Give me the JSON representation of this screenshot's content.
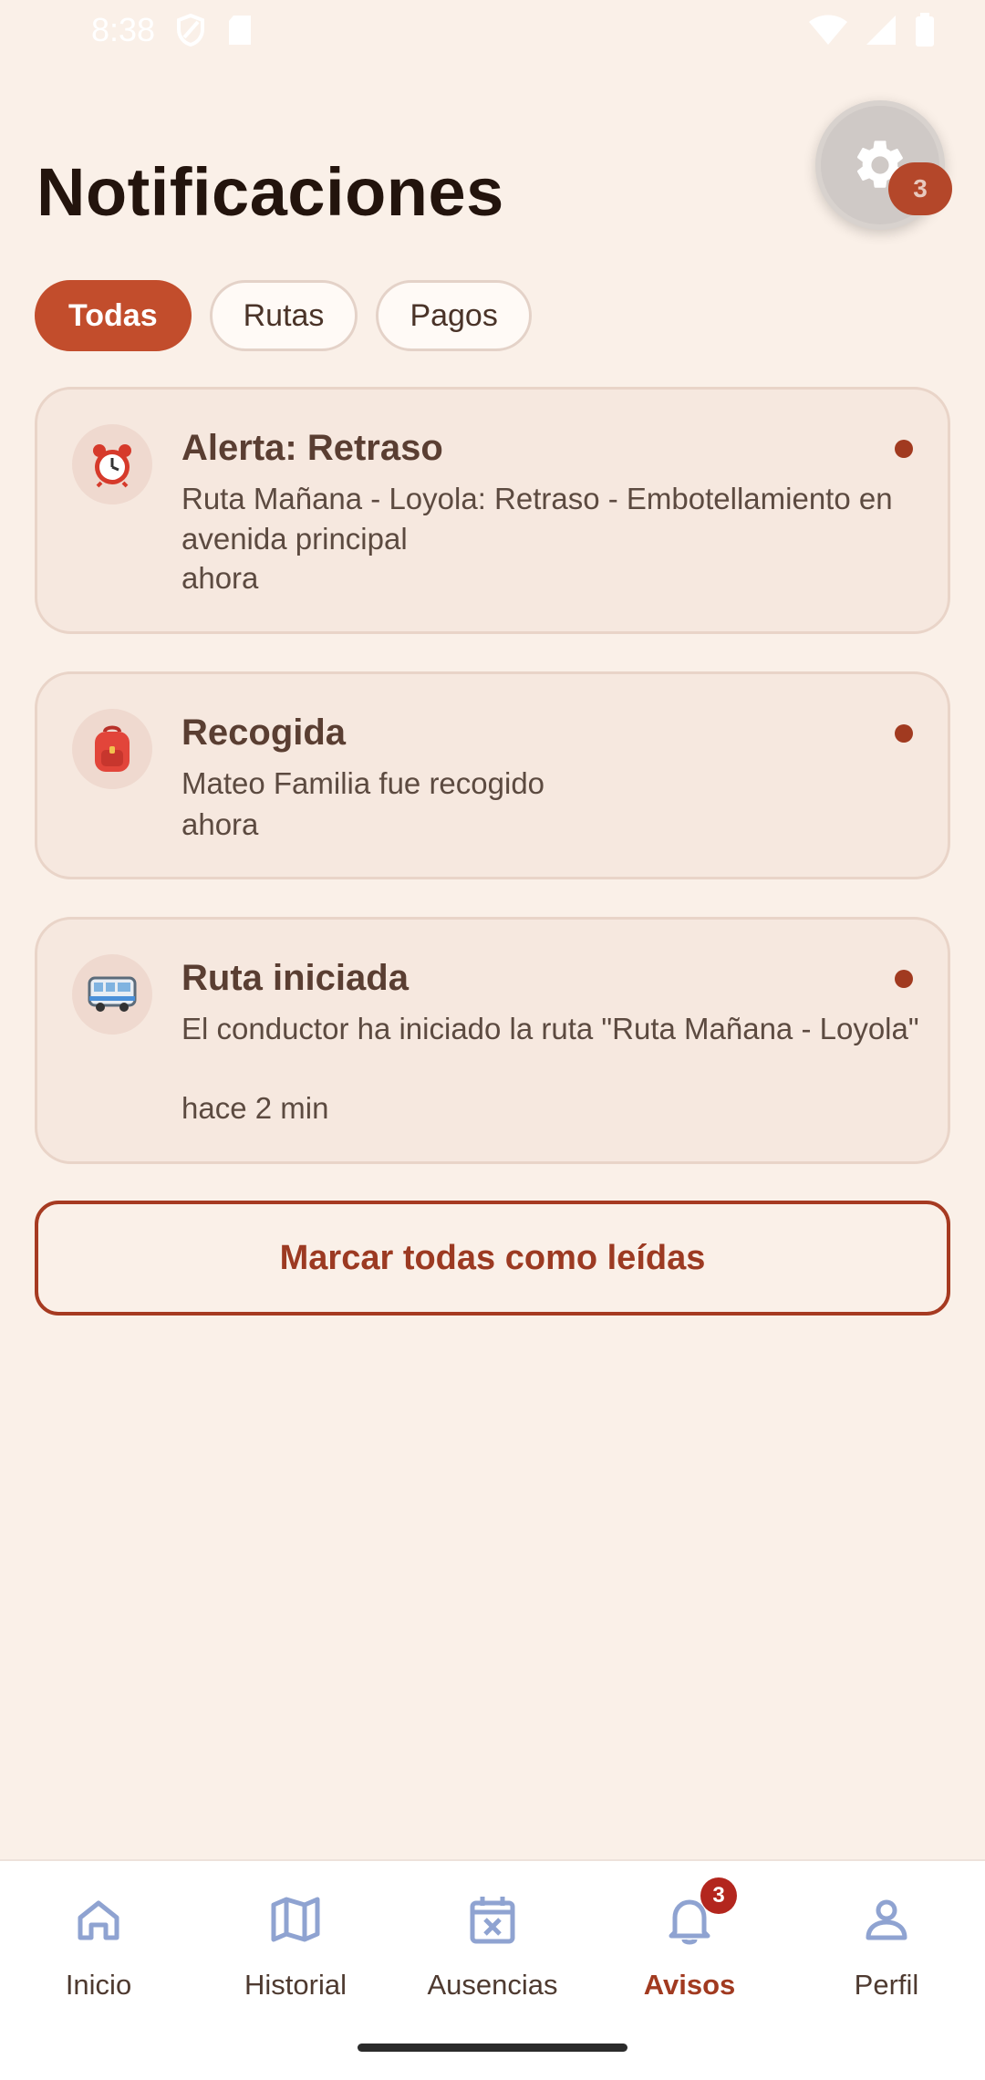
{
  "status_bar": {
    "time": "8:38"
  },
  "header": {
    "title": "Notificaciones",
    "settings_badge": "3"
  },
  "filters": [
    {
      "label": "Todas",
      "active": true
    },
    {
      "label": "Rutas",
      "active": false
    },
    {
      "label": "Pagos",
      "active": false
    }
  ],
  "notifications": [
    {
      "icon": "alarm-clock-icon",
      "title": "Alerta: Retraso",
      "message": "Ruta Mañana - Loyola: Retraso - Embotellamiento en avenida principal",
      "time": "ahora",
      "unread": true
    },
    {
      "icon": "backpack-icon",
      "title": "Recogida",
      "message": "Mateo Familia fue recogido",
      "time": "ahora",
      "unread": true
    },
    {
      "icon": "bus-icon",
      "title": "Ruta iniciada",
      "message": "El conductor ha iniciado la ruta \"Ruta Mañana - Loyola\"",
      "time": "hace 2 min",
      "unread": true
    }
  ],
  "mark_all_label": "Marcar todas como leídas",
  "bottom_nav": [
    {
      "label": "Inicio",
      "icon": "home-icon",
      "active": false
    },
    {
      "label": "Historial",
      "icon": "map-icon",
      "active": false
    },
    {
      "label": "Ausencias",
      "icon": "calendar-x-icon",
      "active": false
    },
    {
      "label": "Avisos",
      "icon": "bell-icon",
      "active": true,
      "badge": "3"
    },
    {
      "label": "Perfil",
      "icon": "person-icon",
      "active": false
    }
  ],
  "colors": {
    "background": "#FAF0E8",
    "accent": "#C24D2C",
    "nav_icon": "#8FA3D1",
    "unread_dot": "#A13A20"
  }
}
